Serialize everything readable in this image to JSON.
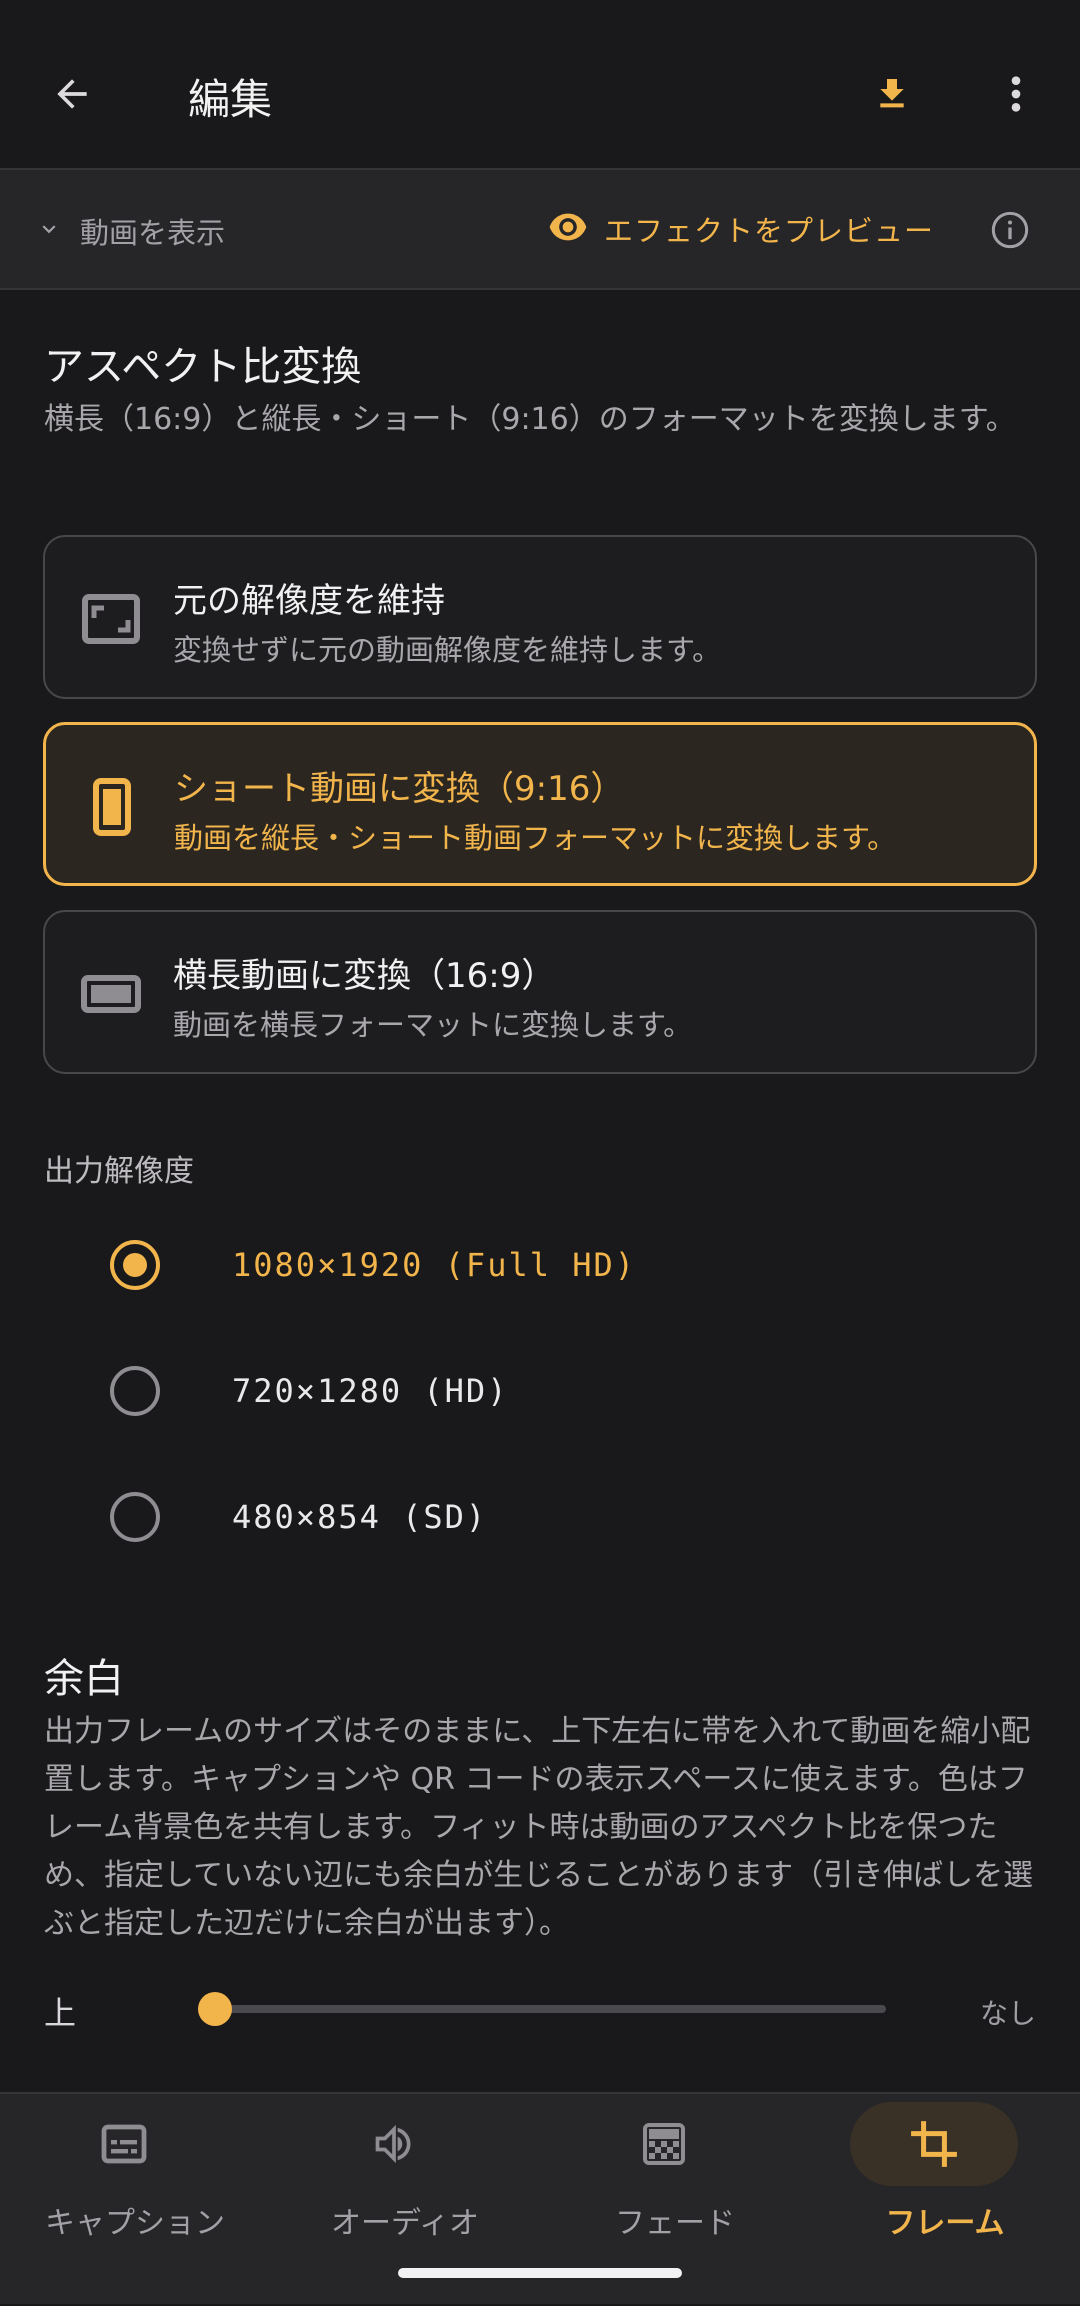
{
  "appbar": {
    "title": "編集"
  },
  "preview": {
    "toggle_label": "動画を表示",
    "effect_label": "エフェクトをプレビュー"
  },
  "aspect": {
    "title": "アスペクト比変換",
    "description": "横長（16:9）と縦長・ショート（9:16）のフォーマットを変換します。",
    "options": [
      {
        "title": "元の解像度を維持",
        "desc": "変換せずに元の動画解像度を維持します。",
        "icon": "aspect-ratio-icon",
        "selected": false
      },
      {
        "title": "ショート動画に変換（9:16）",
        "desc": "動画を縦長・ショート動画フォーマットに変換します。",
        "icon": "portrait-phone-icon",
        "selected": true
      },
      {
        "title": "横長動画に変換（16:9）",
        "desc": "動画を横長フォーマットに変換します。",
        "icon": "landscape-icon",
        "selected": false
      }
    ]
  },
  "resolution": {
    "label": "出力解像度",
    "options": [
      {
        "label": "1080×1920 (Full HD)",
        "selected": true
      },
      {
        "label": "720×1280 (HD)",
        "selected": false
      },
      {
        "label": "480×854 (SD)",
        "selected": false
      }
    ]
  },
  "margin": {
    "title": "余白",
    "description": "出力フレームのサイズはそのままに、上下左右に帯を入れて動画を縮小配置します。キャプションや QR コードの表示スペースに使えます。色はフレーム背景色を共有します。フィット時は動画のアスペクト比を保つため、指定していない辺にも余白が生じることがあります（引き伸ばしを選ぶと指定した辺だけに余白が出ます）。",
    "slider_label": "上",
    "slider_value": "なし",
    "slider_level": 0
  },
  "bottom_nav": {
    "items": [
      {
        "label": "キャプション",
        "icon": "subtitles-icon",
        "active": false
      },
      {
        "label": "オーディオ",
        "icon": "speaker-icon",
        "active": false
      },
      {
        "label": "フェード",
        "icon": "gradient-icon",
        "active": false
      },
      {
        "label": "フレーム",
        "icon": "crop-icon",
        "active": true
      }
    ]
  },
  "colors": {
    "accent": "#f2b54c",
    "background": "#19181a",
    "surface": "#262528"
  }
}
